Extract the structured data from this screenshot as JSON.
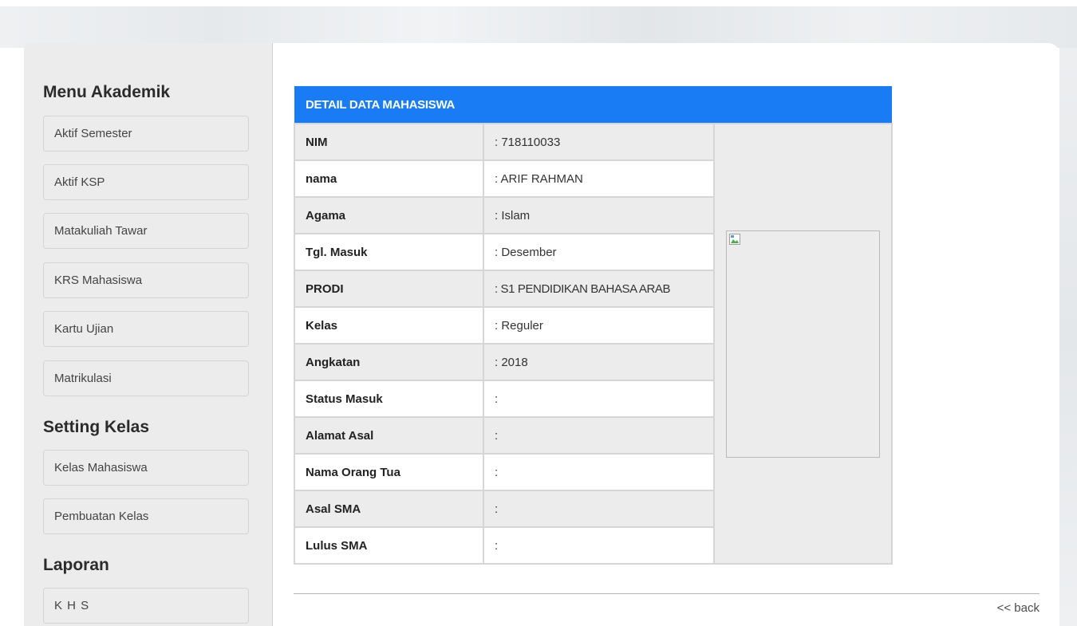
{
  "sidebar": {
    "sections": [
      {
        "heading": "Menu Akademik",
        "items": [
          "Aktif Semester",
          "Aktif KSP",
          "Matakuliah Tawar",
          "KRS Mahasiswa",
          "Kartu Ujian",
          "Matrikulasi"
        ]
      },
      {
        "heading": "Setting Kelas",
        "items": [
          "Kelas Mahasiswa",
          "Pembuatan Kelas"
        ]
      },
      {
        "heading": "Laporan",
        "items": [
          "K H S"
        ]
      }
    ]
  },
  "detail": {
    "title": "DETAIL DATA MAHASISWA",
    "rows": [
      {
        "label": "NIM",
        "value": ": 718110033"
      },
      {
        "label": "nama",
        "value": ": ARIF RAHMAN"
      },
      {
        "label": "Agama",
        "value": ": Islam"
      },
      {
        "label": "Tgl. Masuk",
        "value": ": Desember"
      },
      {
        "label": "PRODI",
        "value": ": S1 PENDIDIKAN BAHASA ARAB"
      },
      {
        "label": "Kelas",
        "value": ": Reguler"
      },
      {
        "label": "Angkatan",
        "value": ": 2018"
      },
      {
        "label": "Status Masuk",
        "value": ":"
      },
      {
        "label": "Alamat Asal",
        "value": ":"
      },
      {
        "label": "Nama Orang Tua",
        "value": ":"
      },
      {
        "label": "Asal SMA",
        "value": ":"
      },
      {
        "label": "Lulus SMA",
        "value": ":"
      }
    ],
    "photo_icon": "broken-image-icon"
  },
  "back_label": "<< back",
  "colors": {
    "header_blue": "#1a7cf5",
    "panel_gray": "#ececec"
  }
}
